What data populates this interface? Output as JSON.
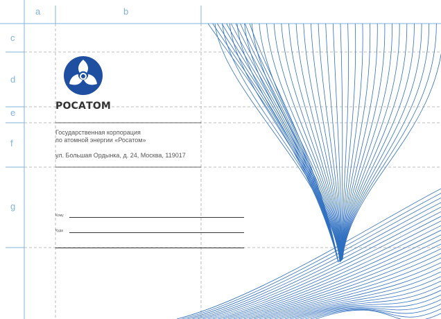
{
  "guides": {
    "columns": [
      "a",
      "b"
    ],
    "rows": [
      "c",
      "d",
      "e",
      "f",
      "g"
    ]
  },
  "brand": {
    "name": "РОСАТОМ",
    "logo_icon": "rosatom-logo-icon",
    "logo_color": "#1f4fa0"
  },
  "sender": {
    "org_line1": "Государственная корпорация",
    "org_line2": "по атомной энергии «Росатом»",
    "address": "ул. Большая Ордынка, д. 24, Москва, 119017"
  },
  "recipient": {
    "to_label": "Кому",
    "where_label": "Куда"
  },
  "colors": {
    "guide": "#7fb3dc",
    "wave": "#2f6fc0",
    "text": "#555555"
  }
}
